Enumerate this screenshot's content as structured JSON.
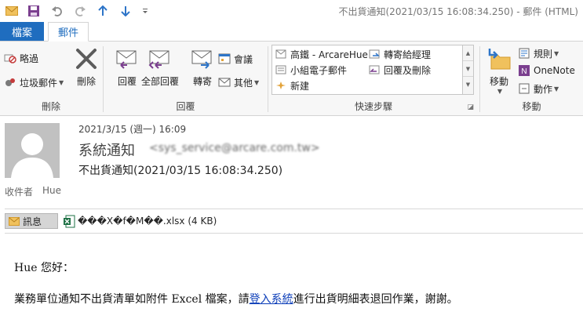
{
  "window": {
    "title": "不出貨通知(2021/03/15 16:08:34.250) - 郵件 (HTML)"
  },
  "quick_access": [
    {
      "icon": "mail-icon",
      "color": "#e3a33a"
    },
    {
      "icon": "save-icon",
      "color": "#7b3f8f"
    },
    {
      "icon": "undo-icon",
      "color": "#8a8a8a"
    },
    {
      "icon": "redo-icon",
      "color": "#b0b0b0"
    },
    {
      "icon": "up-arrow-icon",
      "color": "#2e75c8"
    },
    {
      "icon": "down-arrow-icon",
      "color": "#2e75c8"
    },
    {
      "icon": "customize-icon",
      "color": "#666666"
    }
  ],
  "tabs": {
    "file": "檔案",
    "message": "郵件"
  },
  "ribbon": {
    "delete_group": {
      "label": "刪除",
      "ignore": "略過",
      "junk": "垃圾郵件",
      "delete": "刪除"
    },
    "respond_group": {
      "label": "回覆",
      "reply": "回覆",
      "reply_all": "全部回覆",
      "forward": "轉寄",
      "meeting": "會議",
      "more": "其他"
    },
    "quick_steps": {
      "label": "快速步驟",
      "items": [
        "高鐵 - ArcareHue",
        "轉寄給經理",
        "小組電子郵件",
        "回覆及刪除",
        "新建"
      ]
    },
    "move_group": {
      "label": "移動",
      "move": "移動",
      "rules": "規則",
      "onenote": "OneNote",
      "actions": "動作"
    }
  },
  "message": {
    "sent": "2021/3/15 (週一) 16:09",
    "sender_name": "系統通知",
    "sender_email": "<sys_service@arcare.com.tw>",
    "subject": "不出貨通知(2021/03/15 16:08:34.250)",
    "recipient_label": "收件者",
    "recipient": "Hue"
  },
  "attachments": {
    "message_tab": "訊息",
    "file_name": "���X�f�M��.xlsx (4 KB)"
  },
  "body": {
    "greeting": "Hue 您好：",
    "line_before": "業務單位通知不出貨清單如附件 Excel 檔案，請",
    "link": "登入系統",
    "line_after": "進行出貨明細表退回作業，謝謝。"
  },
  "colors": {
    "accent": "#1f6dbf",
    "link": "#0b3db8",
    "excel": "#1d7044"
  }
}
